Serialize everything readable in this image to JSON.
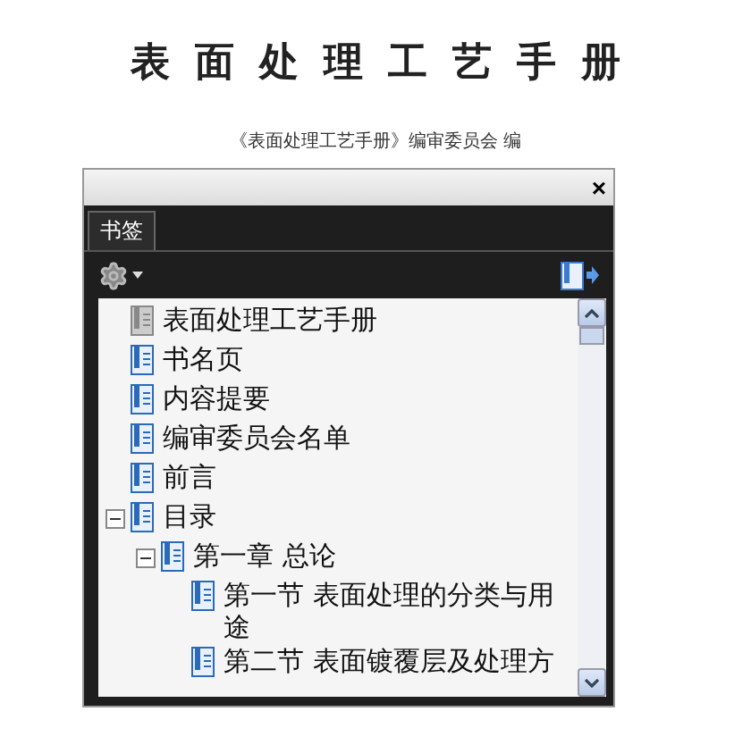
{
  "title": "表面处理工艺手册",
  "subtitle": "《表面处理工艺手册》编审委员会 编",
  "panel": {
    "close": "×",
    "tabs": [
      {
        "label": "书签",
        "selected": true
      }
    ],
    "bookmarks": [
      {
        "label": "表面处理工艺手册",
        "kind": "document"
      },
      {
        "label": "书名页",
        "kind": "bookmark"
      },
      {
        "label": "内容提要",
        "kind": "bookmark"
      },
      {
        "label": "编审委员会名单",
        "kind": "bookmark"
      },
      {
        "label": "前言",
        "kind": "bookmark"
      },
      {
        "label": "目录",
        "kind": "bookmark",
        "expanded": true,
        "children": [
          {
            "label": "第一章 总论",
            "kind": "bookmark",
            "expanded": true,
            "children": [
              {
                "label": "第一节 表面处理的分类与用途",
                "kind": "bookmark"
              },
              {
                "label": "第二节 表面镀覆层及处理方",
                "kind": "bookmark"
              }
            ]
          }
        ]
      }
    ]
  }
}
